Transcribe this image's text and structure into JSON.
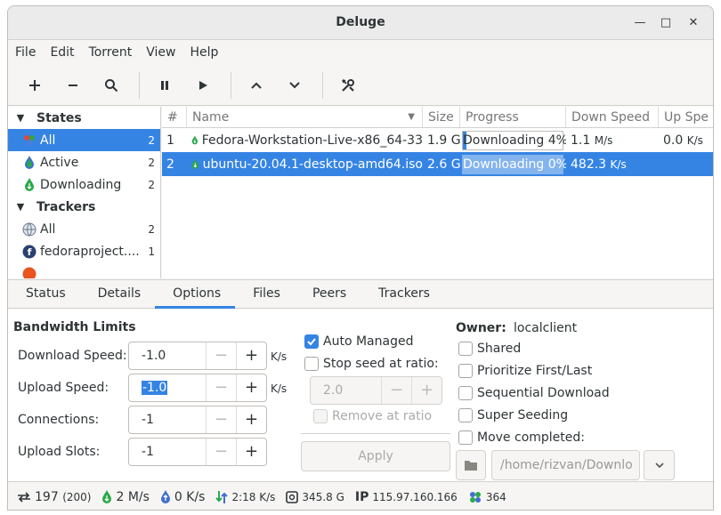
{
  "window": {
    "title": "Deluge"
  },
  "menu": [
    "File",
    "Edit",
    "Torrent",
    "View",
    "Help"
  ],
  "toolbar": {
    "buttons": [
      "add-icon",
      "remove-icon",
      "search-icon",
      "pause-icon",
      "resume-icon",
      "move-up-icon",
      "move-down-icon",
      "preferences-icon"
    ]
  },
  "sidebar": {
    "states_label": "States",
    "states": [
      {
        "label": "All",
        "count": "2"
      },
      {
        "label": "Active",
        "count": "2"
      },
      {
        "label": "Downloading",
        "count": "2"
      }
    ],
    "trackers_label": "Trackers",
    "trackers": [
      {
        "label": "All",
        "count": "2"
      },
      {
        "label": "fedoraproject....",
        "count": "1"
      }
    ]
  },
  "torrents": {
    "columns": [
      "#",
      "Name",
      "Size",
      "Progress",
      "Down Speed",
      "Up Spe"
    ],
    "rows": [
      {
        "num": "1",
        "name": "Fedora-Workstation-Live-x86_64-33",
        "size": "1.9 G",
        "progress_text": "Downloading 4%",
        "progress": 0.04,
        "down": "1.1",
        "down_unit": "M/s",
        "up": "0.0",
        "up_unit": "K/s"
      },
      {
        "num": "2",
        "name": "ubuntu-20.04.1-desktop-amd64.iso",
        "size": "2.6 G",
        "progress_text": "Downloading 0%",
        "progress": 0.0,
        "down": "482.3",
        "down_unit": "K/s",
        "up": "",
        "up_unit": ""
      }
    ]
  },
  "tabs": [
    "Status",
    "Details",
    "Options",
    "Files",
    "Peers",
    "Trackers"
  ],
  "options": {
    "bandwidth_title": "Bandwidth Limits",
    "download_speed": {
      "label": "Download Speed:",
      "value": "-1.0",
      "unit": "K/s"
    },
    "upload_speed": {
      "label": "Upload Speed:",
      "value": "-1.0",
      "unit": "K/s"
    },
    "connections": {
      "label": "Connections:",
      "value": "-1"
    },
    "upload_slots": {
      "label": "Upload Slots:",
      "value": "-1"
    },
    "auto_managed": "Auto Managed",
    "stop_seed": "Stop seed at ratio:",
    "ratio_value": "2.0",
    "remove_at_ratio": "Remove at ratio",
    "apply": "Apply",
    "owner_label": "Owner:",
    "owner_value": "localclient",
    "shared": "Shared",
    "prioritize": "Prioritize First/Last",
    "sequential": "Sequential Download",
    "super_seeding": "Super Seeding",
    "move_completed": "Move completed:",
    "move_path": "/home/rizvan/Downlo"
  },
  "statusbar": {
    "connections": "197",
    "connections_max": "(200)",
    "down": "2 M/s",
    "up": "0 K/s",
    "protocol": "2:18 K/s",
    "disk": "345.8 G",
    "ip_label": "IP",
    "ip": "115.97.160.166",
    "dht": "364"
  }
}
